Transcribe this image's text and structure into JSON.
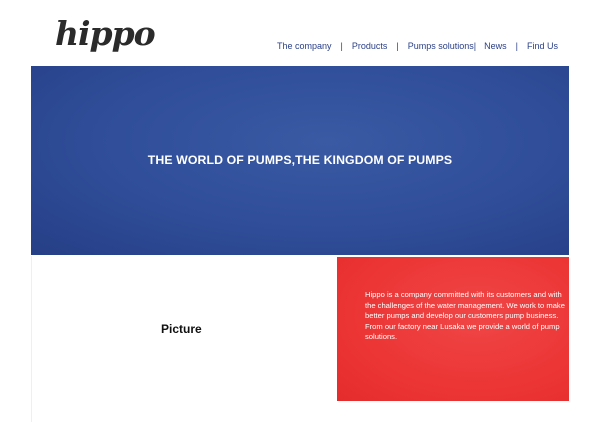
{
  "brand": {
    "logo_text": "hippo"
  },
  "nav": {
    "items": [
      {
        "label": "The company"
      },
      {
        "label": "Products"
      },
      {
        "label": "Pumps solutions"
      },
      {
        "label": "News"
      },
      {
        "label": "Find Us"
      }
    ],
    "separator": "|"
  },
  "hero": {
    "title": "THE WORLD OF PUMPS,THE KINGDOM OF PUMPS",
    "background_color": "#2f4d99"
  },
  "picture": {
    "label": "Picture"
  },
  "about": {
    "text": "Hippo is a company committed with its customers and with the challenges of the water management. We work to make better pumps and develop our customers pump business. From our factory near Lusaka we provide a world of pump solutions.",
    "background_color": "#ec3535"
  },
  "colors": {
    "nav_text": "#2a3f86",
    "hero_blue": "#2f4d99",
    "accent_red": "#ec3535"
  }
}
